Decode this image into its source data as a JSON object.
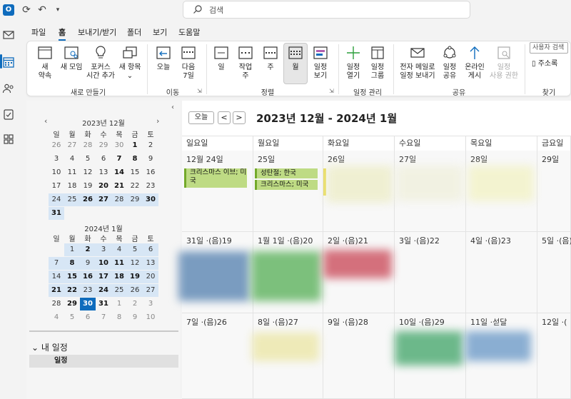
{
  "titlebar": {
    "search_placeholder": "검색",
    "app_logo": "O"
  },
  "menu_tabs": [
    "파일",
    "홈",
    "보내기/받기",
    "폴더",
    "보기",
    "도움말"
  ],
  "ribbon": {
    "new_group": {
      "label": "새로 만들기",
      "buttons": [
        {
          "label": "새\n약속",
          "icon": "new-appointment-icon"
        },
        {
          "label": "새 모임",
          "icon": "new-meeting-icon"
        },
        {
          "label": "포커스\n시간 추가",
          "icon": "focus-time-icon"
        },
        {
          "label": "새 항목",
          "icon": "new-item-icon"
        }
      ]
    },
    "goto_group": {
      "label": "이동",
      "buttons": [
        {
          "label": "오늘"
        },
        {
          "label": "다음\n7일"
        }
      ]
    },
    "arrange_group": {
      "label": "정렬",
      "buttons": [
        {
          "label": "일"
        },
        {
          "label": "작업\n주"
        },
        {
          "label": "주"
        },
        {
          "label": "월"
        },
        {
          "label": "일정\n보기"
        }
      ]
    },
    "manage_group": {
      "label": "일정 관리",
      "buttons": [
        {
          "label": "일정\n열기"
        },
        {
          "label": "일정\n그룹"
        }
      ]
    },
    "share_group": {
      "label": "공유",
      "buttons": [
        {
          "label": "전자 메일로\n일정 보내기"
        },
        {
          "label": "일정\n공유"
        },
        {
          "label": "온라인\n게시"
        },
        {
          "label": "일정\n사용 권한"
        }
      ]
    },
    "find_group": {
      "label": "찾기",
      "user_search": "사용자 검색",
      "address_book": "주소록"
    }
  },
  "minicals": [
    {
      "header": "2023년 12월",
      "dow": [
        "일",
        "월",
        "화",
        "수",
        "목",
        "금",
        "토"
      ]
    },
    {
      "header": "2024년 1월",
      "dow": [
        "일",
        "월",
        "화",
        "수",
        "목",
        "금",
        "토"
      ]
    }
  ],
  "left_pane": {
    "section": "내 일정",
    "calendar_item": "일정"
  },
  "main": {
    "today_button": "오늘",
    "prev": "<",
    "next": ">",
    "range_title": "2023년 12월 - 2024년 1월",
    "day_headers": [
      "일요일",
      "월요일",
      "화요일",
      "수요일",
      "목요일",
      "금요일"
    ],
    "rows": [
      [
        "12월 24일",
        "25일",
        "26일",
        "27일",
        "28일",
        "29일"
      ],
      [
        "31일 ·(음)19",
        "1월 1일 ·(음)20",
        "2일 ·(음)21",
        "3일 ·(음)22",
        "4일 ·(음)23",
        "5일 ·(음)"
      ],
      [
        "7일 ·(음)26",
        "8일 ·(음)27",
        "9일 ·(음)28",
        "10일 ·(음)29",
        "11일 ·섣달",
        "12일 ·("
      ]
    ],
    "events": {
      "xmas_eve": "크리스마스 이브; 미국",
      "xmas_kr": "성탄절; 한국",
      "xmas_us": "크리스마스; 미국"
    }
  },
  "colors": {
    "accent": "#0f6cbd",
    "holiday_green": "#bedb84"
  }
}
